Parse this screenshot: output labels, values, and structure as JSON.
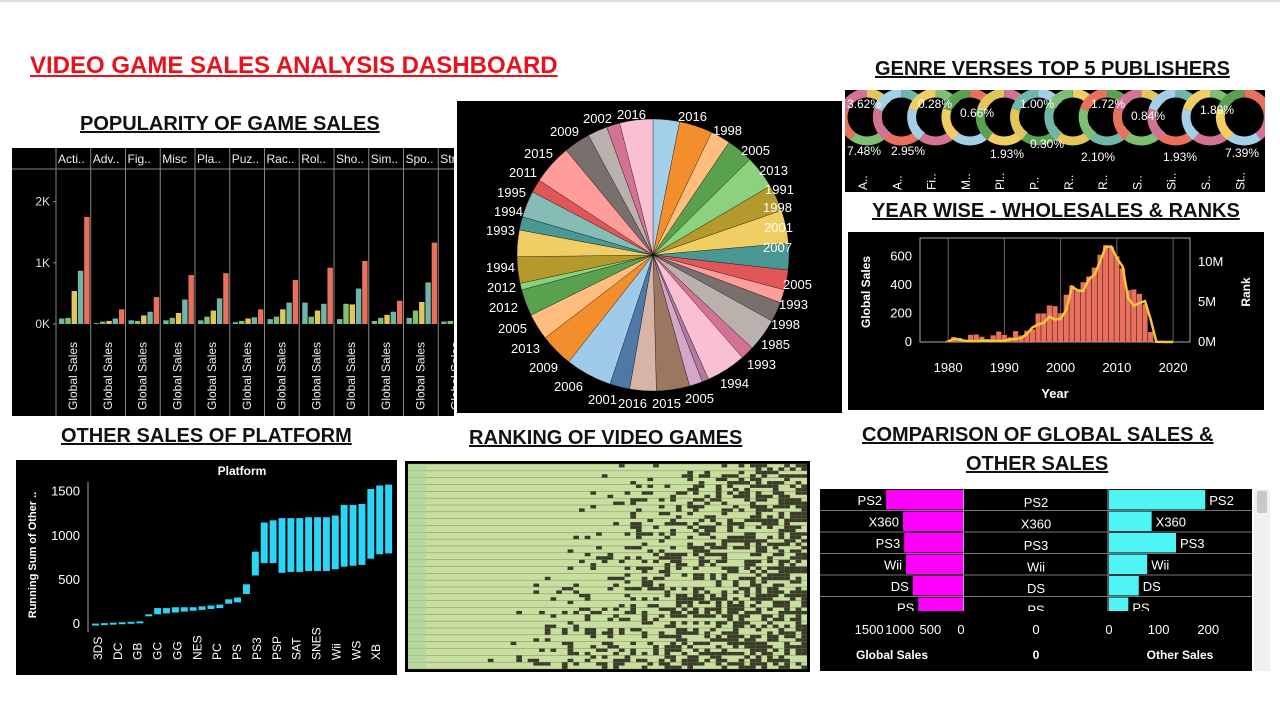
{
  "dashboard": {
    "title": "VIDEO GAME SALES ANALYSIS DASHBOARD"
  },
  "titles": {
    "popularity": "POPULARITY OF GAME SALES",
    "genre_publishers": "GENRE VERSES TOP 5 PUBLISHERS",
    "year_wise": "YEAR WISE - WHOLESALES & RANKS",
    "other_sales": "OTHER SALES OF PLATFORM",
    "ranking": "RANKING OF VIDEO GAMES",
    "comparison_line1": "COMPARISON OF GLOBAL SALES &",
    "comparison_line2": "OTHER SALES"
  },
  "colors": {
    "orange_red": "#e8705c",
    "teal": "#6fb5aa",
    "yellow": "#e3c65a",
    "green": "#7fbf74",
    "cyan": "#2bd5f5",
    "magenta": "#ff00ff",
    "light_cyan": "#4ff5f5",
    "line_yellow": "#f5c53a"
  },
  "chart_data": [
    {
      "id": "popularity",
      "type": "bar",
      "columns": [
        "Acti..",
        "Adv..",
        "Fig..",
        "Misc",
        "Pla..",
        "Puz..",
        "Rac..",
        "Rol..",
        "Sho..",
        "Sim..",
        "Spo..",
        "Str.."
      ],
      "xlabel": "Global Sales",
      "yticks": [
        "2K",
        "1K",
        "0K"
      ],
      "ylim": [
        0,
        2500
      ],
      "series_colors": [
        "#6fb5aa",
        "#7fbf74",
        "#e3c65a",
        "#6fb5aa",
        "#e8705c"
      ],
      "values": [
        [
          90,
          100,
          540,
          870,
          1750
        ],
        [
          15,
          40,
          50,
          90,
          240
        ],
        [
          60,
          50,
          140,
          200,
          440
        ],
        [
          60,
          100,
          180,
          400,
          800
        ],
        [
          60,
          120,
          220,
          420,
          830
        ],
        [
          30,
          50,
          90,
          110,
          240
        ],
        [
          80,
          120,
          240,
          350,
          720
        ],
        [
          350,
          120,
          220,
          330,
          920
        ],
        [
          80,
          330,
          320,
          580,
          1030
        ],
        [
          50,
          100,
          150,
          200,
          380
        ],
        [
          100,
          220,
          360,
          680,
          1330
        ],
        [
          40,
          50,
          60,
          80,
          170
        ]
      ]
    },
    {
      "id": "pie_years",
      "type": "pie",
      "labels_right": [
        "2016",
        "1998",
        "2005",
        "2013",
        "1991",
        "1998",
        "2001",
        "2007",
        "2005",
        "1993",
        "1998",
        "1985",
        "1993",
        "1994",
        "2005"
      ],
      "labels_left": [
        "2016",
        "2002",
        "2009",
        "2015",
        "2011",
        "1995",
        "1994",
        "1993",
        "1994",
        "2012",
        "2012",
        "2005",
        "2013",
        "2009",
        "2006",
        "2001",
        "2016",
        "2015"
      ],
      "values": [
        4,
        5,
        3,
        4,
        5,
        4,
        5,
        4,
        3,
        2,
        3,
        5,
        2,
        6,
        1,
        2,
        5,
        4,
        3,
        7,
        5,
        4,
        4,
        1,
        4,
        4,
        2,
        4,
        2,
        6,
        4,
        3,
        2,
        5
      ],
      "colors": [
        "#a3cfe8",
        "#f28e2b",
        "#ffbe7d",
        "#59a14f",
        "#8cd17d",
        "#b6992d",
        "#f1ce63",
        "#499894",
        "#e15759",
        "#ff9d9a",
        "#79706e",
        "#bab0ac",
        "#d37295",
        "#fabfd2",
        "#b07aa1",
        "#d4a6c8",
        "#9d7660",
        "#d7b5a6",
        "#4e79a7",
        "#a0cbe8",
        "#f28e2b",
        "#ffbe7d",
        "#59a14f",
        "#8cd17d",
        "#b6992d",
        "#f1ce63",
        "#499894",
        "#86bcb6",
        "#e15759",
        "#ff9d9a",
        "#79706e",
        "#bab0ac",
        "#d37295",
        "#fabfd2"
      ]
    },
    {
      "id": "genre_publishers",
      "type": "pie",
      "percent_top": [
        "3.62%",
        "0.28%",
        "0.66%",
        "1.00%",
        "1.72%",
        "0.84%",
        "1.89%"
      ],
      "percent_bottom": [
        "7.48%",
        "2.95%",
        "1.93%",
        "0.30%",
        "2.10%",
        "1.93%",
        "7.39%"
      ],
      "columns": [
        "A..",
        "A..",
        "Fi..",
        "M..",
        "Pl..",
        "P..",
        "R..",
        "R..",
        "S..",
        "Si..",
        "S..",
        "St.."
      ]
    },
    {
      "id": "year_wise",
      "type": "bar",
      "xlabel": "Year",
      "ylabel": "Global Sales",
      "y2label": "Rank",
      "xticks": [
        "1980",
        "1990",
        "2000",
        "2010",
        "2020"
      ],
      "yticks": [
        "0",
        "200",
        "400",
        "600"
      ],
      "y2ticks": [
        "0M",
        "5M",
        "10M"
      ],
      "ylim": [
        0,
        700
      ],
      "x": [
        1980,
        1981,
        1982,
        1983,
        1984,
        1985,
        1986,
        1987,
        1988,
        1989,
        1990,
        1991,
        1992,
        1993,
        1994,
        1995,
        1996,
        1997,
        1998,
        1999,
        2000,
        2001,
        2002,
        2003,
        2004,
        2005,
        2006,
        2007,
        2008,
        2009,
        2010,
        2011,
        2012,
        2013,
        2014,
        2015,
        2016,
        2017,
        2018,
        2019,
        2020
      ],
      "values": [
        11,
        35,
        28,
        17,
        50,
        53,
        37,
        21,
        47,
        73,
        49,
        32,
        76,
        46,
        79,
        88,
        199,
        200,
        256,
        251,
        201,
        331,
        395,
        357,
        419,
        459,
        521,
        611,
        678,
        667,
        600,
        515,
        363,
        368,
        337,
        264,
        70,
        0,
        0,
        0,
        0
      ],
      "line": [
        9,
        46,
        36,
        17,
        14,
        14,
        21,
        16,
        15,
        16,
        16,
        41,
        43,
        60,
        121,
        219,
        263,
        289,
        379,
        338,
        349,
        482,
        829,
        775,
        763,
        941,
        1008,
        1202,
        1428,
        1431,
        1255,
        1136,
        657,
        546,
        582,
        614,
        344,
        3,
        1,
        0,
        1
      ]
    },
    {
      "id": "other_sales_platform",
      "type": "bar",
      "title": "Platform",
      "ylabel": "Running Sum of Other ..",
      "yticks": [
        "0",
        "500",
        "1000",
        "1500"
      ],
      "ylim": [
        0,
        1700
      ],
      "categories": [
        "3DS",
        "DC",
        "GB",
        "GC",
        "GG",
        "NES",
        "PC",
        "PS",
        "PS3",
        "PSP",
        "SAT",
        "SNES",
        "Wii",
        "WS",
        "XB"
      ],
      "ranges": [
        [
          0,
          5
        ],
        [
          5,
          10
        ],
        [
          10,
          15
        ],
        [
          15,
          20
        ],
        [
          20,
          25
        ],
        [
          25,
          30
        ],
        [
          100,
          110
        ],
        [
          110,
          180
        ],
        [
          120,
          180
        ],
        [
          130,
          190
        ],
        [
          140,
          190
        ],
        [
          150,
          190
        ],
        [
          160,
          200
        ],
        [
          170,
          210
        ],
        [
          180,
          220
        ],
        [
          230,
          280
        ],
        [
          245,
          300
        ],
        [
          340,
          450
        ],
        [
          550,
          820
        ],
        [
          690,
          1150
        ],
        [
          690,
          1175
        ],
        [
          580,
          1200
        ],
        [
          590,
          1200
        ],
        [
          590,
          1200
        ],
        [
          600,
          1210
        ],
        [
          600,
          1210
        ],
        [
          600,
          1210
        ],
        [
          620,
          1230
        ],
        [
          650,
          1350
        ],
        [
          660,
          1350
        ],
        [
          670,
          1360
        ],
        [
          740,
          1530
        ],
        [
          790,
          1570
        ],
        [
          800,
          1580
        ]
      ]
    },
    {
      "id": "ranking",
      "type": "heatmap",
      "rows": 60,
      "cols": 70
    },
    {
      "id": "comparison",
      "type": "bar",
      "categories": [
        "PS2",
        "X360",
        "PS3",
        "Wii",
        "DS",
        "PS"
      ],
      "global_sales": [
        1255,
        980,
        960,
        930,
        820,
        730
      ],
      "other_sales": [
        194,
        86,
        135,
        77,
        60,
        39
      ],
      "global_xticks": [
        "1500",
        "1000",
        "500",
        "0"
      ],
      "other_xticks": [
        "0",
        "100",
        "200"
      ],
      "mid_xtick": "0",
      "xlabel_global": "Global Sales",
      "xlabel_mid": "0",
      "xlabel_other": "Other Sales"
    }
  ]
}
